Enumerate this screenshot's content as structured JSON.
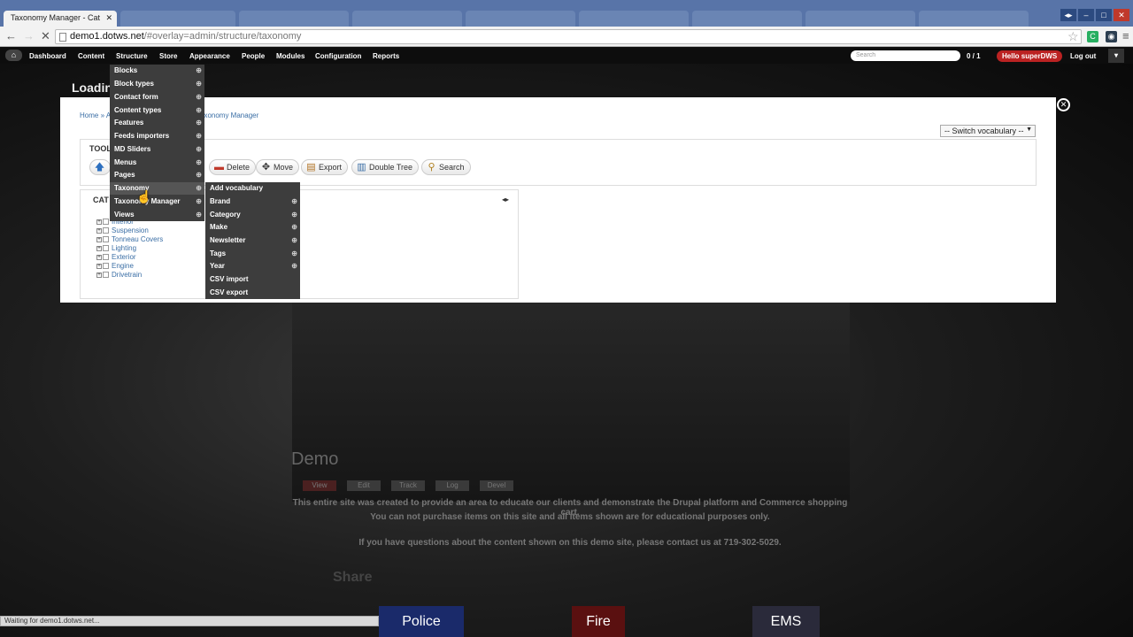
{
  "browser": {
    "active_tab_title": "Taxonomy Manager - Cat",
    "url_host": "demo1.dotws.net",
    "url_path": "/#overlay=admin/structure/taxonomy",
    "status_text": "Waiting for demo1.dotws.net..."
  },
  "admin_toolbar": {
    "items": [
      "Dashboard",
      "Content",
      "Structure",
      "Store",
      "Appearance",
      "People",
      "Modules",
      "Configuration",
      "Reports"
    ],
    "search_placeholder": "Search",
    "count": "0 / 1",
    "greeting": "Hello superDWS",
    "logout": "Log out"
  },
  "structure_menu": {
    "items": [
      "Blocks",
      "Block types",
      "Contact form",
      "Content types",
      "Features",
      "Feeds importers",
      "MD Sliders",
      "Menus",
      "Pages",
      "Taxonomy",
      "Taxonomy Manager",
      "Views"
    ]
  },
  "taxonomy_menu": {
    "items": [
      "Add vocabulary",
      "Brand",
      "Category",
      "Make",
      "Newsletter",
      "Tags",
      "Year",
      "CSV import",
      "CSV export"
    ]
  },
  "overlay": {
    "breadcrumb_home": "Home",
    "breadcrumb_sep": "»",
    "breadcrumb_a": "A",
    "breadcrumb_tail": "axonomy Manager",
    "switch_vocabulary": "-- Switch vocabulary --",
    "tools_legend": "TOOL",
    "buttons": {
      "delete": "Delete",
      "move": "Move",
      "export": "Export",
      "double_tree": "Double Tree",
      "search": "Search"
    },
    "tree_legend": "CAT",
    "tree_terms": [
      "Interior",
      "Suspension",
      "Tonneau Covers",
      "Lighting",
      "Exterior",
      "Engine",
      "Drivetrain"
    ]
  },
  "background_page": {
    "loading": "Loadin",
    "title": "Demo",
    "tabs": [
      "View",
      "Edit",
      "Track",
      "Log",
      "Devel"
    ],
    "paragraph_1": "This entire site was created to provide an area to educate our clients and demonstrate the Drupal platform and Commerce shopping cart.",
    "paragraph_2": "You can not purchase items on this site and all items shown are for educational purposes only.",
    "paragraph_3": "If you have questions about the content shown on this demo site, please contact us at 719-302-5029.",
    "share": "Share",
    "banners": [
      "Police",
      "Fire",
      "EMS"
    ]
  },
  "colors": {
    "toolbar_bg": "#0d0d0d",
    "menu_bg": "#3d3d3d",
    "link": "#3a6ea5",
    "greeting_badge": "#b22222"
  }
}
